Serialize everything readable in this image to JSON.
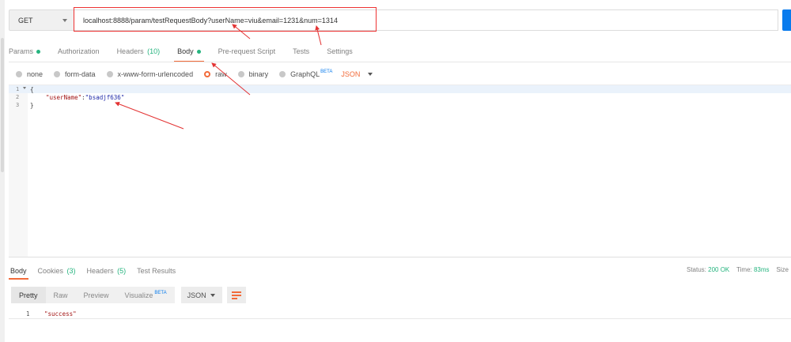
{
  "request": {
    "method": "GET",
    "url": "localhost:8888/param/testRequestBody?userName=viu&email=1231&num=1314"
  },
  "request_tabs": [
    {
      "label": "Params",
      "count": "",
      "dot": true
    },
    {
      "label": "Authorization",
      "count": "",
      "dot": false
    },
    {
      "label": "Headers",
      "count": "(10)",
      "dot": false
    },
    {
      "label": "Body",
      "count": "",
      "dot": true
    },
    {
      "label": "Pre-request Script",
      "count": "",
      "dot": false
    },
    {
      "label": "Tests",
      "count": "",
      "dot": false
    },
    {
      "label": "Settings",
      "count": "",
      "dot": false
    }
  ],
  "body_types": [
    "none",
    "form-data",
    "x-www-form-urlencoded",
    "raw",
    "binary",
    "GraphQL"
  ],
  "body_selected": "raw",
  "graphql_badge": "BETA",
  "body_language": "JSON",
  "editor": {
    "line_numbers": [
      "1",
      "2",
      "3"
    ],
    "line1": "{",
    "key": "\"userName\"",
    "colon": ":",
    "value": "\"bsadjf636\"",
    "line3": "}"
  },
  "response_tabs": [
    {
      "label": "Body",
      "count": ""
    },
    {
      "label": "Cookies",
      "count": "(3)"
    },
    {
      "label": "Headers",
      "count": "(5)"
    },
    {
      "label": "Test Results",
      "count": ""
    }
  ],
  "status": {
    "status_label": "Status:",
    "status_value": "200 OK",
    "time_label": "Time:",
    "time_value": "83ms",
    "size_label": "Size"
  },
  "view_modes": [
    "Pretty",
    "Raw",
    "Preview",
    "Visualize"
  ],
  "visualize_badge": "BETA",
  "response_format": "JSON",
  "response_body": {
    "line_number": "1",
    "text": "\"success\""
  },
  "colors": {
    "accent": "#f26b3a",
    "success": "#26b47f",
    "link_blue": "#097bed",
    "annotation_red": "#e33333"
  }
}
